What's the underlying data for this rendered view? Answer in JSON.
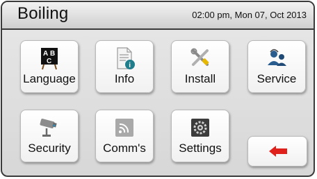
{
  "header": {
    "title": "Boiling",
    "datetime": "02:00 pm, Mon 07, Oct 2013"
  },
  "tiles": [
    {
      "label": "Language",
      "icon": "language-icon",
      "glyphs": [
        "A",
        "B",
        "C"
      ]
    },
    {
      "label": "Info",
      "icon": "info-icon",
      "badge": "i"
    },
    {
      "label": "Install",
      "icon": "install-tools-icon"
    },
    {
      "label": "Service",
      "icon": "service-icon"
    },
    {
      "label": "Security",
      "icon": "security-camera-icon"
    },
    {
      "label": "Comm's",
      "icon": "comms-signal-icon"
    },
    {
      "label": "Settings",
      "icon": "settings-gear-icon"
    }
  ],
  "back_button": {
    "icon": "back-arrow-icon",
    "color": "#e0201a"
  }
}
